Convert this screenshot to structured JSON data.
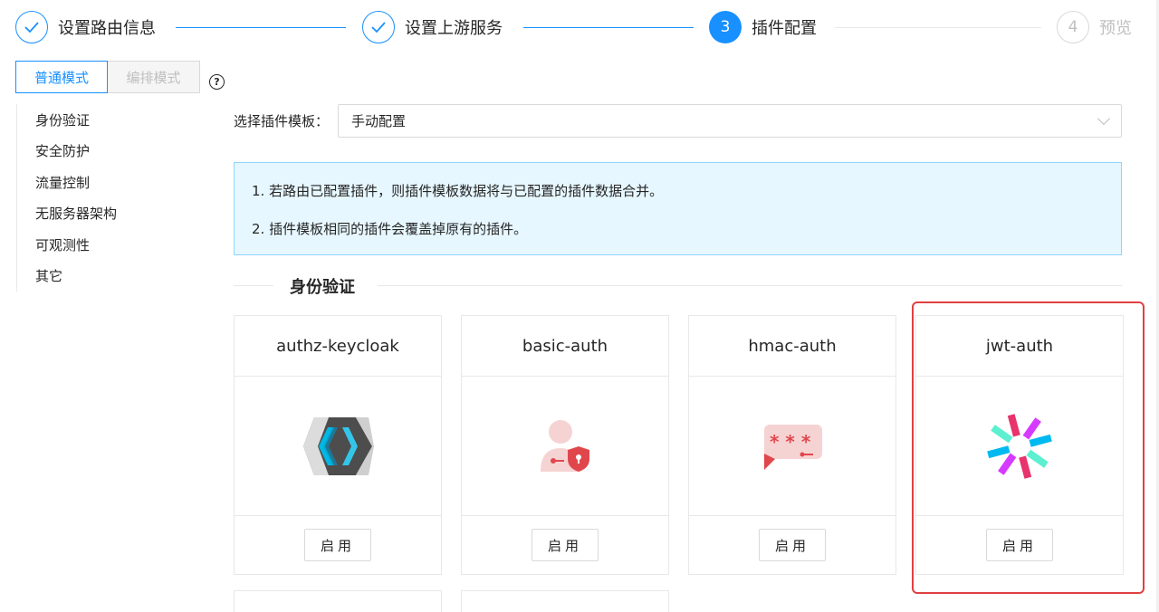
{
  "steps": [
    {
      "label": "设置路由信息",
      "status": "done"
    },
    {
      "label": "设置上游服务",
      "status": "done"
    },
    {
      "number": "3",
      "label": "插件配置",
      "status": "active"
    },
    {
      "number": "4",
      "label": "预览",
      "status": "wait"
    }
  ],
  "mode_tabs": {
    "normal": "普通模式",
    "orchestration": "编排模式"
  },
  "sidebar": {
    "items": [
      {
        "label": "身份验证"
      },
      {
        "label": "安全防护"
      },
      {
        "label": "流量控制"
      },
      {
        "label": "无服务器架构"
      },
      {
        "label": "可观测性"
      },
      {
        "label": "其它"
      }
    ]
  },
  "template": {
    "label": "选择插件模板：",
    "value": "手动配置"
  },
  "alert": {
    "lines": [
      "1. 若路由已配置插件，则插件模板数据将与已配置的插件数据合并。",
      "2. 插件模板相同的插件会覆盖掉原有的插件。"
    ]
  },
  "section": {
    "title": "身份验证"
  },
  "cards": [
    {
      "name": "authz-keycloak",
      "button": "启用",
      "icon": "keycloak-icon"
    },
    {
      "name": "basic-auth",
      "button": "启用",
      "icon": "basic-auth-icon"
    },
    {
      "name": "hmac-auth",
      "button": "启用",
      "icon": "hmac-auth-icon"
    },
    {
      "name": "jwt-auth",
      "button": "启用",
      "icon": "jwt-icon"
    }
  ],
  "colors": {
    "primary": "#1890ff",
    "highlight": "#e04040",
    "alert_bg": "#e6f7ff"
  }
}
